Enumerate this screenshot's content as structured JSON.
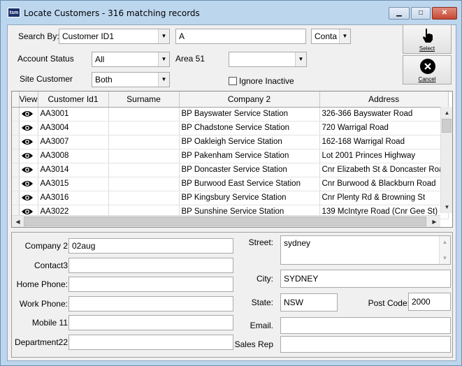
{
  "window": {
    "icon_text": "tsm",
    "title": "Locate Customers -  316 matching records",
    "minimize_glyph": "▁",
    "maximize_glyph": "□",
    "close_glyph": "✕"
  },
  "search": {
    "search_by_label": "Search By:",
    "search_by_value": "Customer ID1",
    "search_text": "A",
    "match_mode_value": "Conta",
    "account_status_label": "Account Status",
    "account_status_value": "All",
    "area_label": "Area 51",
    "area_value": "",
    "site_customer_label": "Site Customer",
    "site_customer_value": "Both",
    "ignore_inactive_label": "Ignore Inactive",
    "ignore_inactive_checked": false
  },
  "buttons": {
    "select_label": "Select",
    "cancel_label": "Cancel"
  },
  "grid": {
    "columns": [
      "View",
      "Customer Id1",
      "Surname",
      "Company 2",
      "Address"
    ],
    "rows": [
      {
        "id": "AA3001",
        "surname": "",
        "company": "BP Bayswater Service Station",
        "address": "326-366 Bayswater Road"
      },
      {
        "id": "AA3004",
        "surname": "",
        "company": "BP Chadstone Service Station",
        "address": "720 Warrigal Road"
      },
      {
        "id": "AA3007",
        "surname": "",
        "company": "BP Oakleigh Service Station",
        "address": "162-168 Warrigal Road"
      },
      {
        "id": "AA3008",
        "surname": "",
        "company": "BP Pakenham Service Station",
        "address": "Lot 2001 Princes Highway"
      },
      {
        "id": "AA3014",
        "surname": "",
        "company": "BP Doncaster Service Station",
        "address": "Cnr Elizabeth St & Doncaster Road"
      },
      {
        "id": "AA3015",
        "surname": "",
        "company": "BP Burwood East Service Station",
        "address": "Cnr Burwood & Blackburn Road"
      },
      {
        "id": "AA3016",
        "surname": "",
        "company": "BP Kingsbury Service Station",
        "address": "Cnr Plenty Rd & Browning St"
      },
      {
        "id": "AA3022",
        "surname": "",
        "company": "BP Sunshine Service Station",
        "address": "139 McIntyre Road (Cnr Gee St)"
      }
    ]
  },
  "detail": {
    "company2_label": "Company 2",
    "company2_value": "02aug",
    "contact3_label": "Contact3",
    "contact3_value": "",
    "home_phone_label": "Home Phone:",
    "home_phone_value": "",
    "work_phone_label": "Work Phone:",
    "work_phone_value": "",
    "mobile_label": "Mobile 11",
    "mobile_value": "",
    "department_label": "Department22",
    "department_value": "",
    "street_label": "Street:",
    "street_value": "sydney",
    "city_label": "City:",
    "city_value": "SYDNEY",
    "state_label": "State:",
    "state_value": "NSW",
    "postcode_label": "Post Code:",
    "postcode_value": "2000",
    "email_label": "Email.",
    "email_value": "",
    "sales_rep_label": "Sales Rep",
    "sales_rep_value": ""
  },
  "icons": {
    "dropdown": "▼",
    "scroll_up": "▲",
    "scroll_down": "▼",
    "scroll_left": "◀",
    "scroll_right": "▶"
  }
}
